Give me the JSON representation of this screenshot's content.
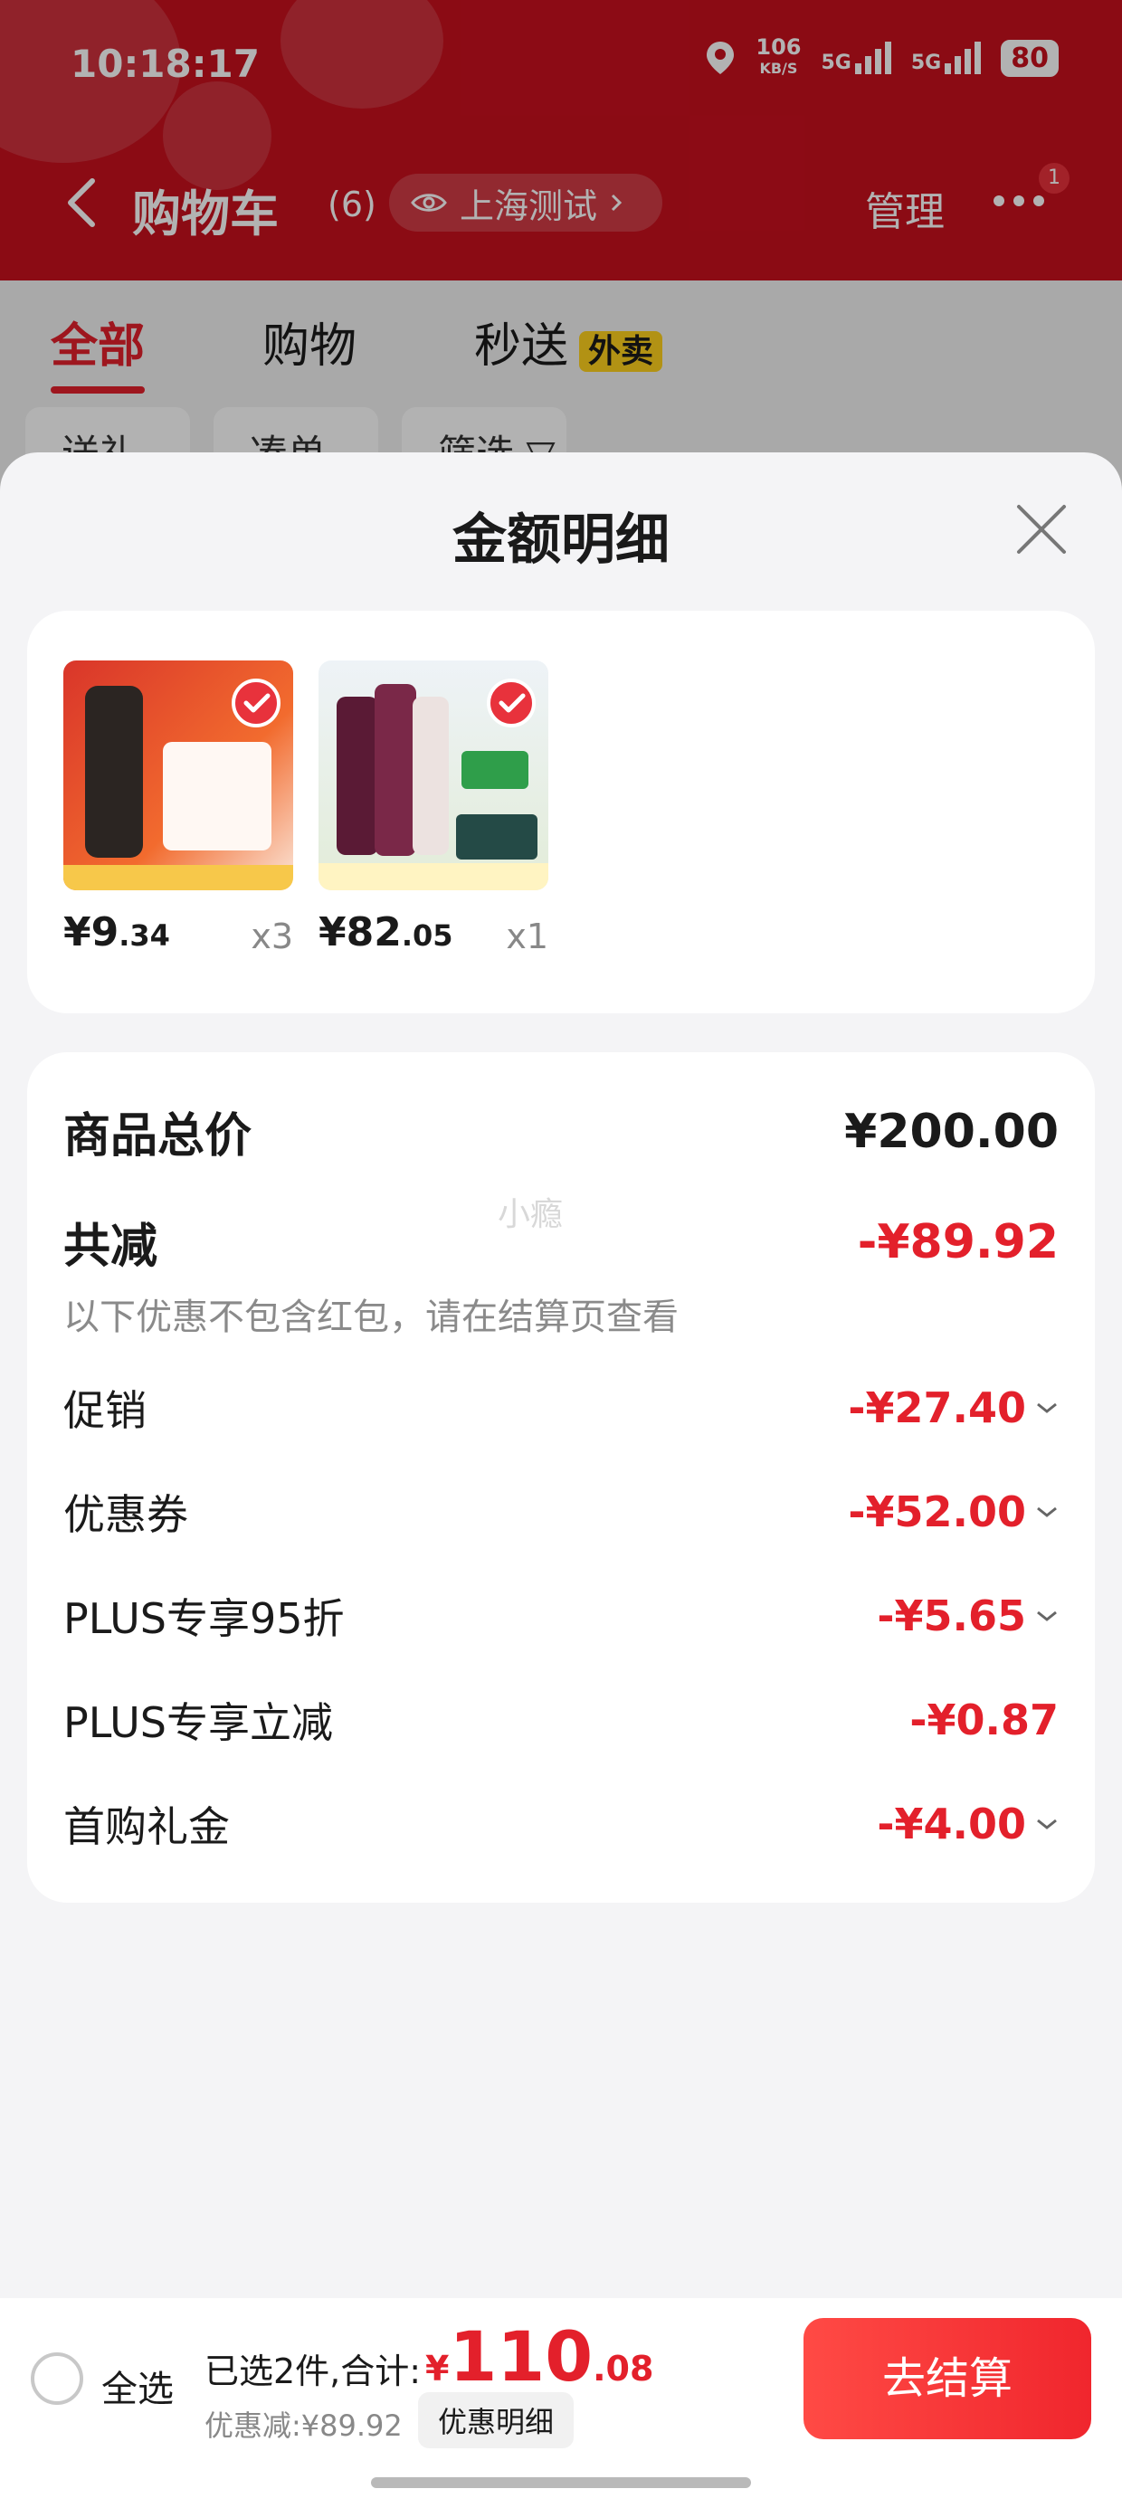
{
  "status_bar": {
    "time": "10:18:17",
    "net_speed": "106",
    "net_speed_unit": "KB/S",
    "sig1": "5G",
    "sig2": "5G",
    "battery": "80"
  },
  "nav": {
    "title": "购物车",
    "count": "(6)",
    "location": "上海测试",
    "manage": "管理",
    "badge": "1"
  },
  "tabs": [
    {
      "label": "全部"
    },
    {
      "label": "购物"
    },
    {
      "label": "秒送",
      "badge": "外卖"
    }
  ],
  "chips": [
    "送礼",
    "凑单",
    "筛选 ▽"
  ],
  "sheet": {
    "title": "金额明细",
    "products": [
      {
        "price_int": "¥9",
        "price_dec": ".34",
        "qty": "x3"
      },
      {
        "price_int": "¥82",
        "price_dec": ".05",
        "qty": "x1"
      }
    ],
    "summary": {
      "total_label": "商品总价",
      "total_value": "¥200.00",
      "watermark": "小瘾",
      "reduce_label": "共减",
      "reduce_value": "-¥89.92",
      "note": "以下优惠不包含红包，请在结算页查看",
      "items": [
        {
          "label": "促销",
          "value": "-¥27.40",
          "expandable": true
        },
        {
          "label": "优惠券",
          "value": "-¥52.00",
          "expandable": true
        },
        {
          "label": "PLUS专享95折",
          "value": "-¥5.65",
          "expandable": true
        },
        {
          "label": "PLUS专享立减",
          "value": "-¥0.87",
          "expandable": false
        },
        {
          "label": "首购礼金",
          "value": "-¥4.00",
          "expandable": true
        }
      ]
    }
  },
  "footer": {
    "select_all": "全选",
    "selected": "已选2件,合计:",
    "currency": "¥",
    "total_int": "110",
    "total_dec": ".08",
    "discount": "优惠减:¥89.92",
    "detail": "优惠明细",
    "checkout": "去结算"
  },
  "colors": {
    "brand_red": "#c8101e",
    "accent_red": "#e3202b"
  }
}
